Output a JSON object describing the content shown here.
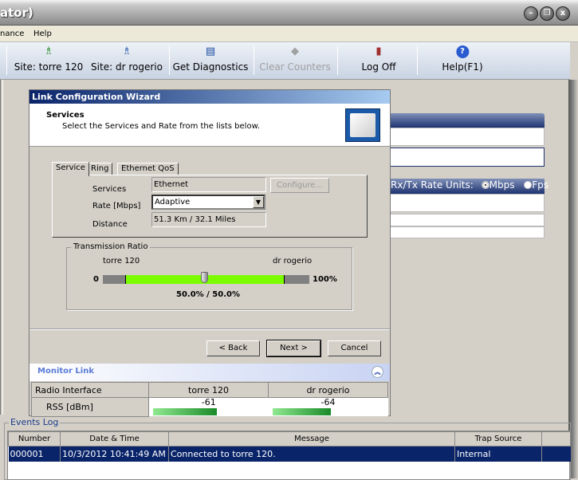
{
  "window": {
    "title": "ator)",
    "buttons": [
      "minimize",
      "restore",
      "close"
    ]
  },
  "menu": [
    "nance",
    "Help"
  ],
  "toolbar": [
    {
      "label": "Site: torre 120",
      "icon": "antenna-icon"
    },
    {
      "label": "Site: dr rogerio",
      "icon": "antenna-icon"
    },
    {
      "label": "Get Diagnostics",
      "icon": "diagnostics-icon"
    },
    {
      "label": "Clear Counters",
      "icon": "eraser-icon",
      "disabled": true
    },
    {
      "label": "Log Off",
      "icon": "door-icon"
    },
    {
      "label": "Help(F1)",
      "icon": "help-icon"
    }
  ],
  "background_panel": {
    "rate_units_label": "Rx/Tx Rate Units:",
    "units": [
      {
        "label": "Mbps",
        "selected": true
      },
      {
        "label": "Fps",
        "selected": false
      }
    ]
  },
  "wizard": {
    "title": "Link Configuration Wizard",
    "heading": "Services",
    "subheading": "Select the Services and Rate from the lists below.",
    "tabs": [
      "Service",
      "Ring",
      "Ethernet QoS"
    ],
    "active_tab": "Service",
    "services_label": "Services",
    "services_value": "Ethernet",
    "configure_label": "Configure...",
    "rate_label": "Rate [Mbps]",
    "rate_value": "Adaptive",
    "distance_label": "Distance",
    "distance_value": "51.3 Km / 32.1 Miles",
    "ratio": {
      "title": "Transmission Ratio",
      "left_site": "torre 120",
      "right_site": "dr rogerio",
      "min": "0",
      "max": "100%",
      "value_percent": 50,
      "readout": "50.0% / 50.0%"
    },
    "back_label": "< Back",
    "next_label": "Next >",
    "cancel_label": "Cancel"
  },
  "monitor": {
    "title": "Monitor Link",
    "headers": [
      "Radio Interface",
      "torre 120",
      "dr rogerio"
    ],
    "row_label": "RSS [dBm]",
    "values": [
      "-61",
      "-64"
    ],
    "fill_percent": [
      80,
      73
    ]
  },
  "events": {
    "title": "Events Log",
    "headers": [
      "Number",
      "Date & Time",
      "Message",
      "Trap Source",
      ""
    ],
    "rows": [
      [
        "000001",
        "10/3/2012 10:41:49 AM",
        "Connected to torre 120.",
        "Internal",
        ""
      ]
    ]
  },
  "colors": {
    "selection": "#0a246a",
    "slider_green": "#7cfc00"
  }
}
